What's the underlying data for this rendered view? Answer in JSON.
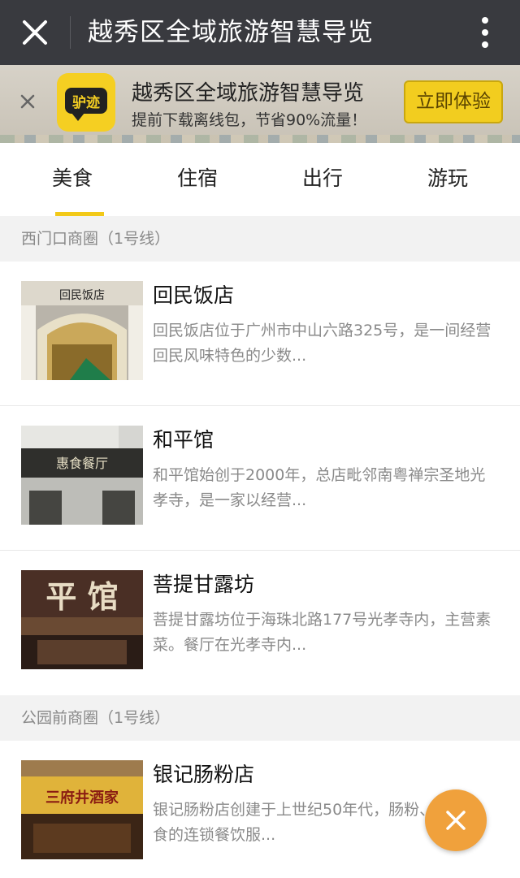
{
  "titlebar": {
    "title": "越秀区全域旅游智慧导览",
    "close_icon": "close-icon",
    "more_icon": "more-vertical-icon"
  },
  "banner": {
    "logo_text": "驴迹",
    "title": "越秀区全域旅游智慧导览",
    "subtitle": "提前下载离线包，节省90%流量！",
    "cta_label": "立即体验",
    "close_icon": "close-icon"
  },
  "tabs": [
    {
      "label": "美食",
      "active": true
    },
    {
      "label": "住宿",
      "active": false
    },
    {
      "label": "出行",
      "active": false
    },
    {
      "label": "游玩",
      "active": false
    }
  ],
  "sections": [
    {
      "title": "西门口商圈（1号线）",
      "items": [
        {
          "name": "回民饭店",
          "desc": "回民饭店位于广州市中山六路325号，是一间经营回民风味特色的少数...",
          "thumb_sign": "回民饭店"
        },
        {
          "name": "和平馆",
          "desc": "和平馆始创于2000年，总店毗邻南粤禅宗圣地光孝寺，是一家以经营...",
          "thumb_sign": "惠食餐厅"
        },
        {
          "name": "菩提甘露坊",
          "desc": "菩提甘露坊位于海珠北路177号光孝寺内，主营素菜。餐厅在光孝寺内...",
          "thumb_sign": "平 馆"
        }
      ]
    },
    {
      "title": "公园前商圈（1号线）",
      "items": [
        {
          "name": "银记肠粉店",
          "desc": "银记肠粉店创建于上世纪50年代，肠粉、粥等美食的连锁餐饮服...",
          "thumb_sign": "三府井酒家"
        }
      ]
    }
  ],
  "colors": {
    "accent": "#f2c918",
    "fab": "#f0a13c",
    "titlebar": "#393a3f"
  },
  "fab": {
    "icon": "close-icon"
  }
}
